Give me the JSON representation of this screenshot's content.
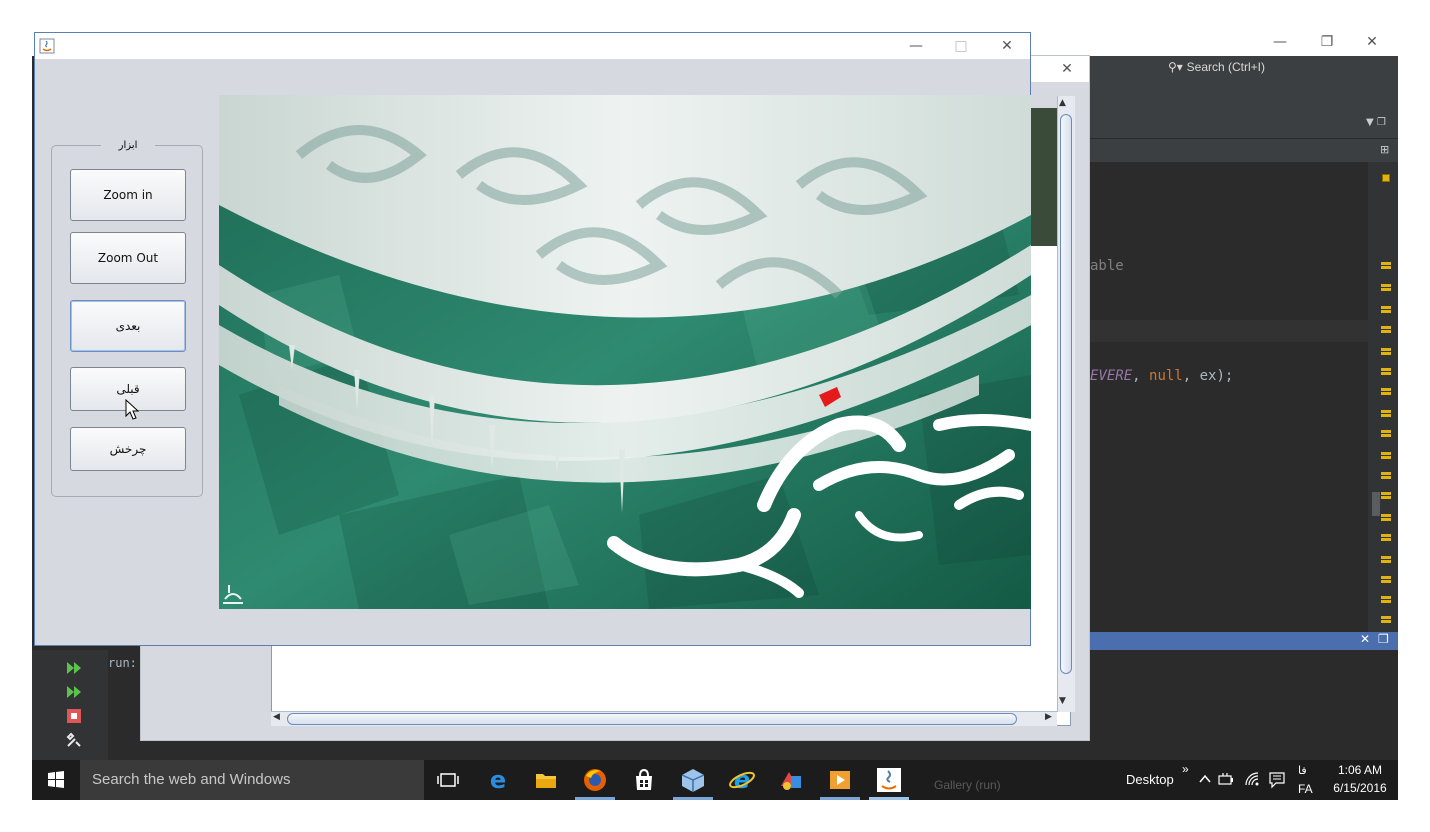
{
  "ide": {
    "search_placeholder": "Search (Ctrl+I)",
    "code_line_1": "able",
    "code_line_2_a": "EVERE",
    "code_line_2_b": ", ",
    "code_line_2_c": "null",
    "code_line_2_d": ", ex);",
    "run_label": "run:"
  },
  "front_window": {
    "tools_group_title": "ابزار",
    "buttons": {
      "zoom_in": "Zoom in",
      "zoom_out": "Zoom Out",
      "next": "بعدی",
      "previous": "قبلی",
      "rotate": "چرخش"
    }
  },
  "taskbar": {
    "search_placeholder": "Search the web and Windows",
    "ghost_text": "Gallery (run)",
    "desktop_label": "Desktop",
    "overflow_chevron": "»",
    "lang_short": "فا",
    "lang_code": "FA",
    "time": "1:06 AM",
    "date": "6/15/2016"
  },
  "colors": {
    "ide_bg": "#2b2b2b",
    "taskbar_bg": "#1c1c1c",
    "window_bg": "#d6d9df",
    "accent": "#1e73be"
  }
}
